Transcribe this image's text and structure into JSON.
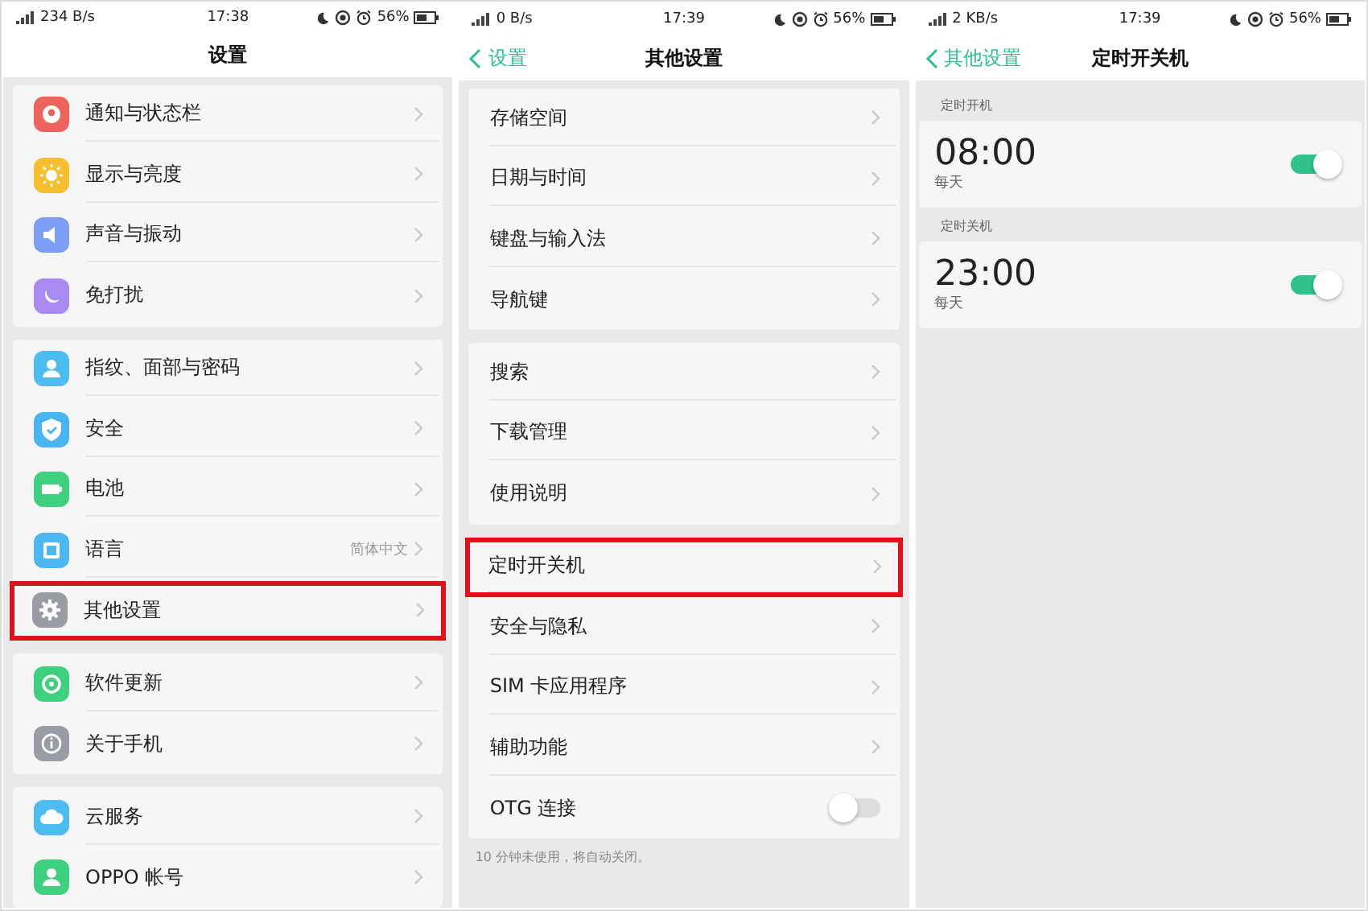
{
  "panels": [
    {
      "kind": "menu",
      "status": {
        "speed": "234 B/s",
        "time": "17:38",
        "battery": "56%"
      },
      "header": {
        "title": "设置"
      },
      "groups": [
        {
          "items": [
            {
              "label": "通知与状态栏",
              "color": "#f0625c",
              "highlighted": false
            },
            {
              "label": "显示与亮度",
              "color": "#f5bf30",
              "highlighted": false
            },
            {
              "label": "声音与振动",
              "color": "#7d9ef5",
              "highlighted": false
            },
            {
              "label": "免打扰",
              "color": "#a98bf2",
              "highlighted": false
            }
          ]
        },
        {
          "items": [
            {
              "label": "指纹、面部与密码",
              "color": "#4dbcf0",
              "highlighted": false
            },
            {
              "label": "安全",
              "color": "#48b5f0",
              "highlighted": false
            },
            {
              "label": "电池",
              "color": "#3ecf7f",
              "highlighted": false
            },
            {
              "label": "语言",
              "value": "简体中文",
              "color": "#4db8f0",
              "highlighted": false
            },
            {
              "label": "其他设置",
              "color": "#9a9ca3",
              "highlighted": true
            }
          ]
        },
        {
          "items": [
            {
              "label": "软件更新",
              "color": "#3ecf7f",
              "highlighted": false
            },
            {
              "label": "关于手机",
              "color": "#9a9ca3",
              "highlighted": false
            }
          ]
        },
        {
          "items": [
            {
              "label": "云服务",
              "color": "#4dbcf0",
              "highlighted": false
            },
            {
              "label": "OPPO 帐号",
              "color": "#3ecf7f",
              "highlighted": false
            }
          ]
        }
      ]
    },
    {
      "kind": "menu",
      "status": {
        "speed": "0 B/s",
        "time": "17:39",
        "battery": "56%"
      },
      "header": {
        "back": "设置",
        "title": "其他设置"
      },
      "groups": [
        {
          "items": [
            {
              "label": "存储空间",
              "highlighted": false
            },
            {
              "label": "日期与时间",
              "highlighted": false
            },
            {
              "label": "键盘与输入法",
              "highlighted": false
            },
            {
              "label": "导航键",
              "highlighted": false
            }
          ]
        },
        {
          "items": [
            {
              "label": "搜索",
              "highlighted": false
            },
            {
              "label": "下载管理",
              "highlighted": false
            },
            {
              "label": "使用说明",
              "highlighted": false
            }
          ]
        },
        {
          "items": [
            {
              "label": "定时开关机",
              "highlighted": true
            },
            {
              "label": "安全与隐私",
              "highlighted": false
            },
            {
              "label": "SIM 卡应用程序",
              "highlighted": false
            },
            {
              "label": "辅助功能",
              "highlighted": false
            },
            {
              "label": "OTG 连接",
              "kind": "toggle",
              "on": false,
              "highlighted": false
            }
          ],
          "note": "10 分钟未使用，将自动关闭。"
        }
      ]
    },
    {
      "kind": "schedule",
      "status": {
        "speed": "2 KB/s",
        "time": "17:39",
        "battery": "56%"
      },
      "header": {
        "back": "其他设置",
        "title": "定时开关机"
      },
      "sections": [
        {
          "label": "定时开机",
          "time": "08:00",
          "repeat": "每天",
          "on": true
        },
        {
          "label": "定时关机",
          "time": "23:00",
          "repeat": "每天",
          "on": true
        }
      ]
    }
  ]
}
